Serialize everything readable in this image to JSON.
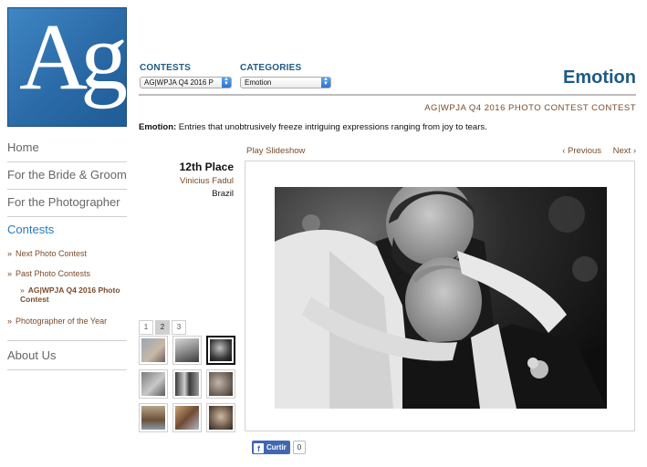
{
  "logo": {
    "text": "Ag"
  },
  "sidebar": {
    "items": [
      {
        "label": "Home"
      },
      {
        "label": "For the Bride & Groom"
      },
      {
        "label": "For the Photographer"
      },
      {
        "label": "Contests"
      },
      {
        "label": "About Us"
      }
    ],
    "contests_sub": [
      {
        "label": "Next Photo Contest"
      },
      {
        "label": "Past Photo Contests"
      },
      {
        "label": "AG|WPJA Q4 2016 Photo Contest"
      },
      {
        "label": "Photographer of the Year"
      }
    ]
  },
  "filters": {
    "contests_label": "CONTESTS",
    "contests_value": "AG|WPJA Q4 2016 P",
    "categories_label": "CATEGORIES",
    "categories_value": "Emotion"
  },
  "header": {
    "title": "Emotion",
    "contest_name": "AG|WPJA Q4 2016 PHOTO CONTEST CONTEST"
  },
  "description": {
    "term": "Emotion:",
    "text": " Entries that unobtrusively freeze intriguing expressions ranging from joy to tears."
  },
  "slideshow": {
    "play_label": "Play Slideshow",
    "prev_label": "‹ Previous",
    "next_label": "Next ›"
  },
  "entry": {
    "place": "12th Place",
    "photographer": "Vinicius Fadul",
    "country": "Brazil"
  },
  "pagination": {
    "pages": [
      "1",
      "2",
      "3"
    ],
    "current": "2"
  },
  "like": {
    "label": "Curtir",
    "count": "0"
  },
  "colors": {
    "brand_blue": "#1e5a86",
    "link_brown": "#7a4b2a",
    "facebook": "#4267b2"
  }
}
